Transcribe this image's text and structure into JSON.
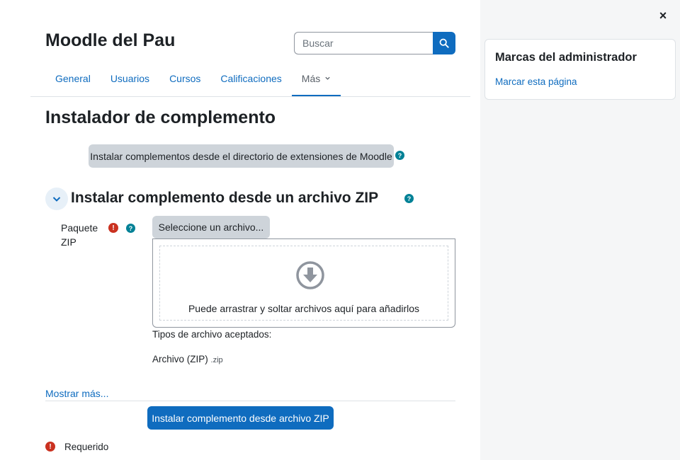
{
  "header": {
    "site_title": "Moodle del Pau",
    "search_placeholder": "Buscar"
  },
  "nav": {
    "items": [
      {
        "label": "General"
      },
      {
        "label": "Usuarios"
      },
      {
        "label": "Cursos"
      },
      {
        "label": "Calificaciones"
      },
      {
        "label": "Más"
      }
    ],
    "active_index": 4
  },
  "main": {
    "page_title": "Instalador de complemento",
    "directory_button": "Instalar complementos desde el directorio de extensiones de Moodle",
    "section_title": "Instalar complemento desde un archivo ZIP",
    "field_label_line1": "Paquete",
    "field_label_line2": "ZIP",
    "file_button": "Seleccione un archivo...",
    "drop_text": "Puede arrastrar y soltar archivos aquí para añadirlos",
    "types_label": "Tipos de archivo aceptados:",
    "type_name": "Archivo (ZIP)",
    "type_ext": ".zip",
    "show_more": "Mostrar más...",
    "submit_button": "Instalar complemento desde archivo ZIP",
    "required_label": "Requerido",
    "help_symbol": "?",
    "required_symbol": "!"
  },
  "drawer": {
    "close_symbol": "×",
    "block_title": "Marcas del administrador",
    "block_link": "Marcar esta página"
  },
  "colors": {
    "primary": "#0f6cbf",
    "help": "#008196",
    "required": "#ca3120",
    "drawer_bg": "#f5f6f7"
  },
  "icons": {
    "search": "search-icon",
    "collapse": "chevron-down-icon",
    "drop": "arrow-down-circle-icon",
    "close": "close-icon",
    "dropdown": "chevron-down-icon"
  }
}
